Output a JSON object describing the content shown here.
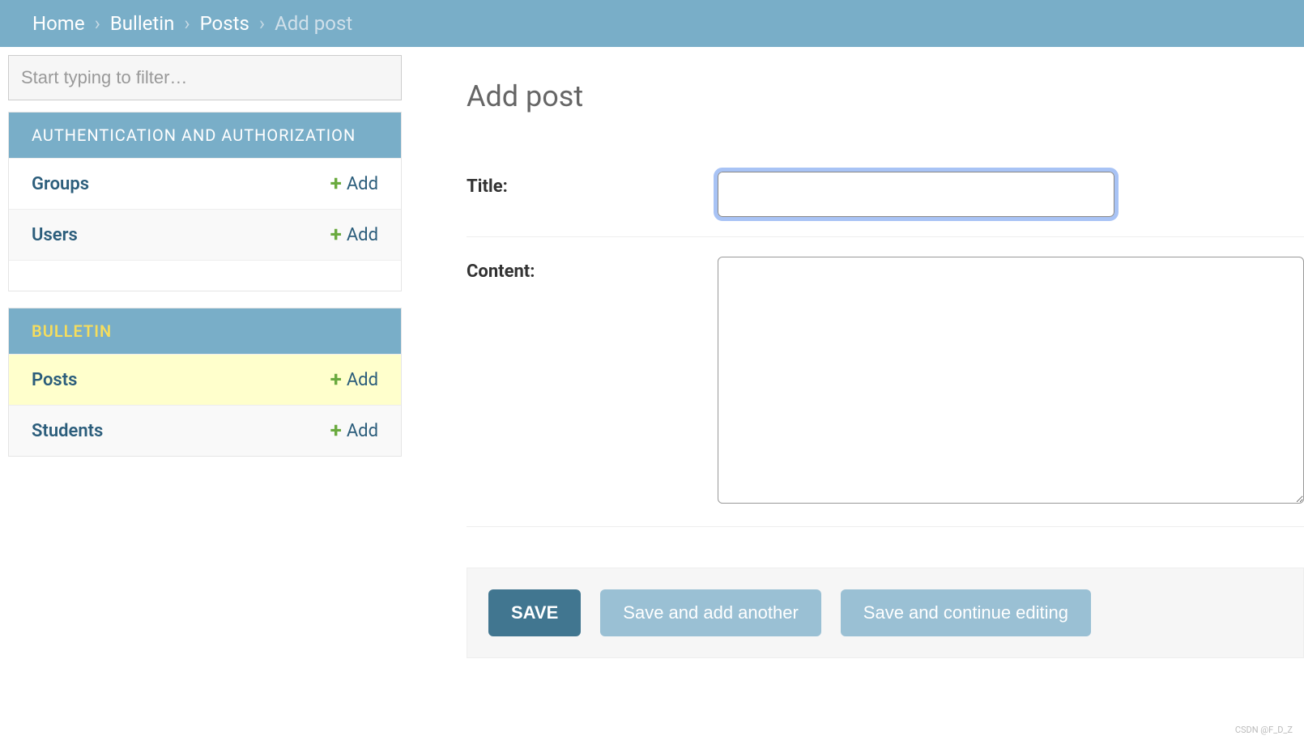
{
  "breadcrumb": {
    "home": "Home",
    "bulletin": "Bulletin",
    "posts": "Posts",
    "current": "Add post"
  },
  "sidebar": {
    "filter_placeholder": "Start typing to filter…",
    "add_label": "Add",
    "sections": [
      {
        "title": "AUTHENTICATION AND AUTHORIZATION",
        "active": false,
        "items": [
          {
            "label": "Groups",
            "highlighted": false
          },
          {
            "label": "Users",
            "highlighted": false
          }
        ]
      },
      {
        "title": "BULLETIN",
        "active": true,
        "items": [
          {
            "label": "Posts",
            "highlighted": true
          },
          {
            "label": "Students",
            "highlighted": false
          }
        ]
      }
    ]
  },
  "page": {
    "title": "Add post"
  },
  "form": {
    "title_label": "Title:",
    "title_value": "",
    "content_label": "Content:",
    "content_value": ""
  },
  "buttons": {
    "save": "SAVE",
    "save_add_another": "Save and add another",
    "save_continue": "Save and continue editing"
  },
  "watermark": "CSDN @F_D_Z"
}
